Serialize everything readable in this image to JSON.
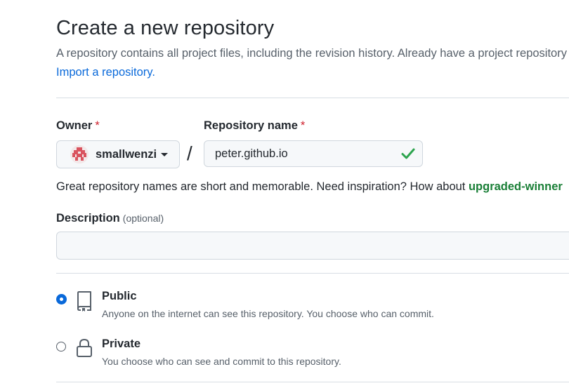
{
  "page": {
    "title": "Create a new repository",
    "subtitle": "A repository contains all project files, including the revision history. Already have a project repository elsewhere?",
    "import_link": "Import a repository."
  },
  "owner": {
    "label": "Owner",
    "required_mark": "*",
    "name": "smallwenzi"
  },
  "slash": "/",
  "repo_name": {
    "label": "Repository name",
    "required_mark": "*",
    "value": "peter.github.io",
    "valid": true
  },
  "hint": {
    "text": "Great repository names are short and memorable. Need inspiration? How about ",
    "suggestion": "upgraded-winner"
  },
  "description": {
    "label": "Description",
    "optional": "(optional)",
    "value": "",
    "placeholder": ""
  },
  "visibility": {
    "selected": "public",
    "options": [
      {
        "id": "public",
        "title": "Public",
        "description": "Anyone on the internet can see this repository. You choose who can commit.",
        "icon": "repo-icon"
      },
      {
        "id": "private",
        "title": "Private",
        "description": "You choose who can see and commit to this repository.",
        "icon": "lock-icon"
      }
    ]
  },
  "colors": {
    "link": "#0969da",
    "success": "#1a7f37",
    "required": "#cf222e",
    "muted": "#57606a"
  }
}
